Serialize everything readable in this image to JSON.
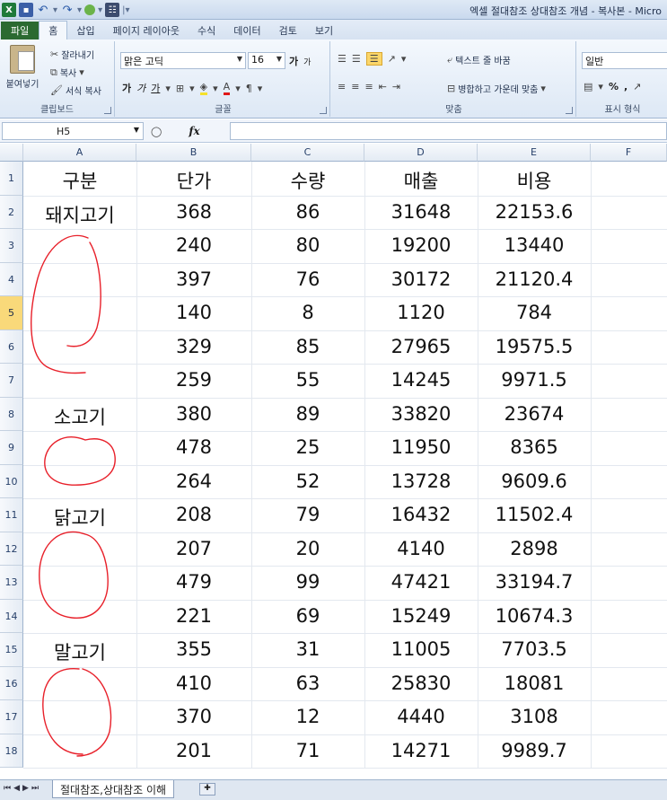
{
  "window": {
    "title": "엑셀 절대참조 상대참조 개념 - 복사본 - Micro"
  },
  "ribbon_tabs": [
    {
      "label": "파일",
      "kind": "file"
    },
    {
      "label": "홈",
      "kind": "active"
    },
    {
      "label": "삽입",
      "kind": "normal"
    },
    {
      "label": "페이지 레이아웃",
      "kind": "normal"
    },
    {
      "label": "수식",
      "kind": "normal"
    },
    {
      "label": "데이터",
      "kind": "normal"
    },
    {
      "label": "검토",
      "kind": "normal"
    },
    {
      "label": "보기",
      "kind": "normal"
    }
  ],
  "clipboard": {
    "paste": "붙여넣기",
    "cut": "잘라내기",
    "copy": "복사",
    "format_painter": "서식 복사",
    "group": "클립보드"
  },
  "font": {
    "name": "맑은 고딕",
    "size": "16",
    "group": "글꼴",
    "bold": "가",
    "italic": "가",
    "underline": "가",
    "grow": "가",
    "shrink": "가"
  },
  "alignment": {
    "wrap": "텍스트 줄 바꿈",
    "merge": "병합하고 가운데 맞춤",
    "group": "맞춤"
  },
  "number": {
    "format": "일반",
    "percent": "%",
    "comma": ",",
    "group": "표시 형식"
  },
  "formula_bar": {
    "name_box": "H5",
    "fx": "fx",
    "value": ""
  },
  "columns": [
    "A",
    "B",
    "C",
    "D",
    "E",
    "F"
  ],
  "rows": [
    [
      "구분",
      "단가",
      "수량",
      "매출",
      "비용"
    ],
    [
      "돼지고기",
      "368",
      "86",
      "31648",
      "22153.6"
    ],
    [
      "",
      "240",
      "80",
      "19200",
      "13440"
    ],
    [
      "",
      "397",
      "76",
      "30172",
      "21120.4"
    ],
    [
      "",
      "140",
      "8",
      "1120",
      "784"
    ],
    [
      "",
      "329",
      "85",
      "27965",
      "19575.5"
    ],
    [
      "",
      "259",
      "55",
      "14245",
      "9971.5"
    ],
    [
      "소고기",
      "380",
      "89",
      "33820",
      "23674"
    ],
    [
      "",
      "478",
      "25",
      "11950",
      "8365"
    ],
    [
      "",
      "264",
      "52",
      "13728",
      "9609.6"
    ],
    [
      "닭고기",
      "208",
      "79",
      "16432",
      "11502.4"
    ],
    [
      "",
      "207",
      "20",
      "4140",
      "2898"
    ],
    [
      "",
      "479",
      "99",
      "47421",
      "33194.7"
    ],
    [
      "",
      "221",
      "69",
      "15249",
      "10674.3"
    ],
    [
      "말고기",
      "355",
      "31",
      "11005",
      "7703.5"
    ],
    [
      "",
      "410",
      "63",
      "25830",
      "18081"
    ],
    [
      "",
      "370",
      "12",
      "4440",
      "3108"
    ],
    [
      "",
      "201",
      "71",
      "14271",
      "9989.7"
    ]
  ],
  "selected_row": 5,
  "sheet": {
    "tab": "절대참조,상대참조 이해"
  },
  "colors": {
    "ink": "#e8202a",
    "file_tab": "#2b6a31",
    "selected_header": "#f9d97a"
  }
}
